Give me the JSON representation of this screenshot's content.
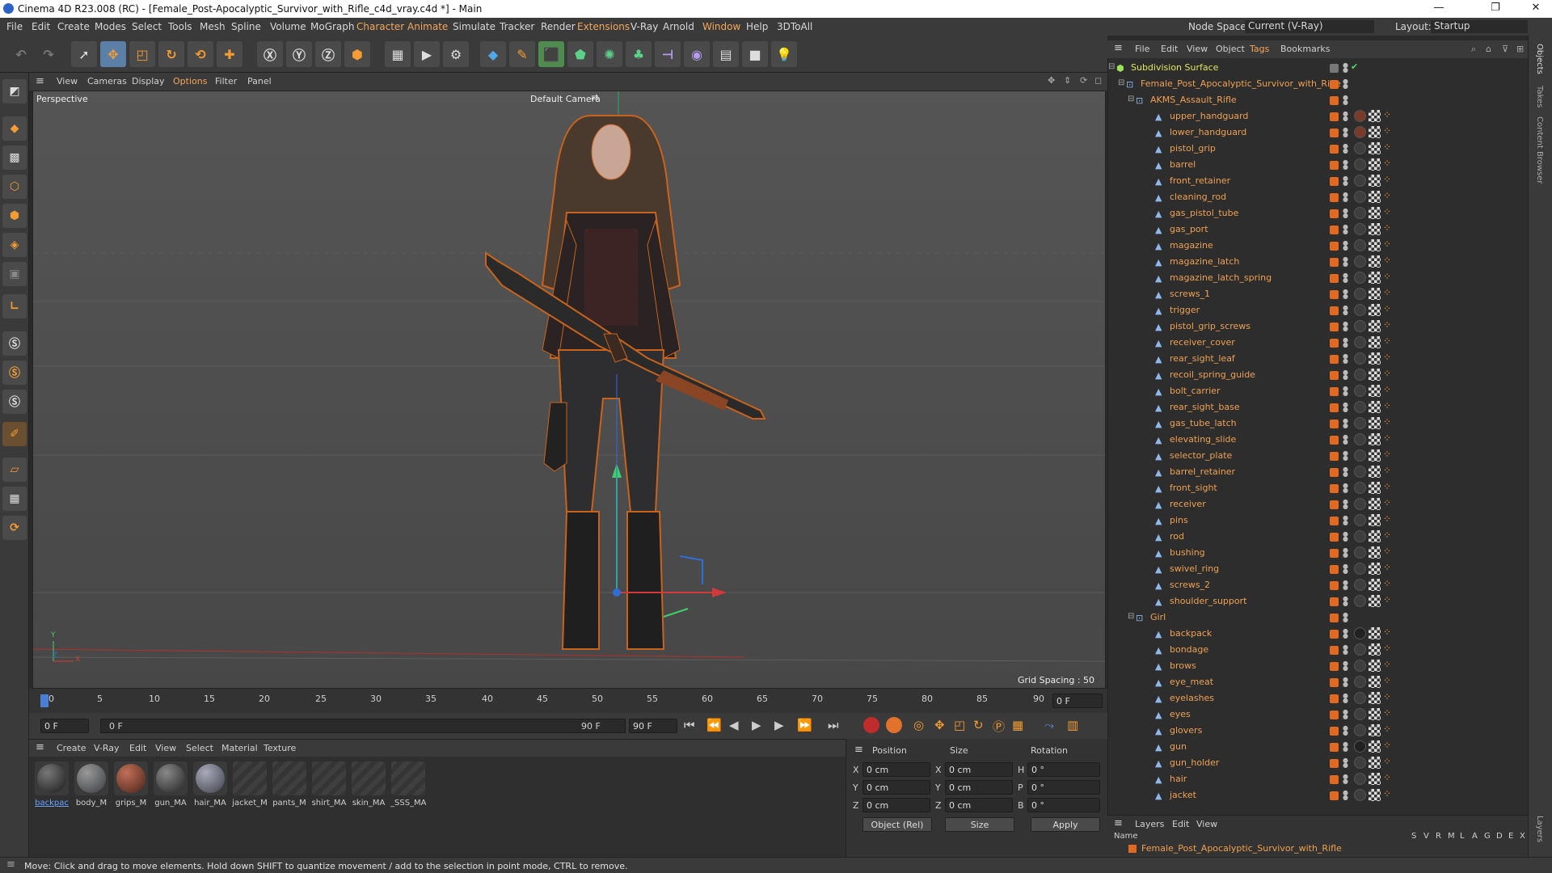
{
  "window": {
    "title": "Cinema 4D R23.008 (RC) - [Female_Post-Apocalyptic_Survivor_with_Rifle_c4d_vray.c4d *] - Main",
    "minimize": "—",
    "maximize": "❐",
    "close": "✕"
  },
  "menubar": {
    "items": [
      "File",
      "Edit",
      "Create",
      "Modes",
      "Select",
      "Tools",
      "Mesh",
      "Spline",
      "Volume",
      "MoGraph",
      "Character",
      "Animate",
      "Simulate",
      "Tracker",
      "Render",
      "Extensions",
      "V-Ray",
      "Arnold",
      "Window",
      "Help",
      "3DToAll"
    ],
    "node_space_label": "Node Space:",
    "node_space_value": "Current (V-Ray)",
    "layout_label": "Layout:",
    "layout_value": "Startup"
  },
  "viewport": {
    "menu": [
      "View",
      "Cameras",
      "Display",
      "Options",
      "Filter",
      "Panel"
    ],
    "name": "Perspective",
    "camera": "Default Camera",
    "grid_spacing": "Grid Spacing : 50 cm",
    "axis_y": "Y",
    "axis_z": "Z",
    "axis_x": "X"
  },
  "timeline": {
    "ticks": [
      "0",
      "5",
      "10",
      "15",
      "20",
      "25",
      "30",
      "35",
      "40",
      "45",
      "50",
      "55",
      "60",
      "65",
      "70",
      "75",
      "80",
      "85",
      "90"
    ],
    "end_field": "0 F",
    "current_start": "0 F",
    "range_start": "0 F",
    "range_end": "90 F",
    "max_field": "90 F"
  },
  "materials": {
    "menu": [
      "Create",
      "V-Ray",
      "Edit",
      "View",
      "Select",
      "Material",
      "Texture"
    ],
    "items": [
      {
        "label": "backpac",
        "color": "#2b2b2b"
      },
      {
        "label": "body_M",
        "color": "#4a4c50"
      },
      {
        "label": "grips_M",
        "color": "#6a3428"
      },
      {
        "label": "gun_MA",
        "color": "#3a3a3a"
      },
      {
        "label": "hair_MA",
        "color": "#5b6068"
      },
      {
        "label": "jacket_M",
        "color": ""
      },
      {
        "label": "pants_M",
        "color": ""
      },
      {
        "label": "shirt_MA",
        "color": ""
      },
      {
        "label": "skin_MA",
        "color": ""
      },
      {
        "label": "_SSS_MA",
        "color": ""
      }
    ]
  },
  "coords": {
    "position": "Position",
    "size": "Size",
    "rotation": "Rotation",
    "x": "X",
    "y": "Y",
    "z": "Z",
    "h": "H",
    "p": "P",
    "b": "B",
    "px": "0 cm",
    "py": "0 cm",
    "pz": "0 cm",
    "sx": "0 cm",
    "sy": "0 cm",
    "sz": "0 cm",
    "rh": "0 °",
    "rp": "0 °",
    "rb": "0 °",
    "mode": "Object (Rel)",
    "size_mode": "Size",
    "apply": "Apply"
  },
  "objects": {
    "menu": [
      "File",
      "Edit",
      "View",
      "Object",
      "Tags",
      "Bookmarks"
    ],
    "root": "Subdivision Surface",
    "group": "Female_Post_Apocalyptic_Survivor_with_Rifle",
    "rifle_group": "AKMS_Assault_Rifle",
    "rifle_parts": [
      "upper_handguard",
      "lower_handguard",
      "pistol_grip",
      "barrel",
      "front_retainer",
      "cleaning_rod",
      "gas_pistol_tube",
      "gas_port",
      "magazine",
      "magazine_latch",
      "magazine_latch_spring",
      "screws_1",
      "trigger",
      "pistol_grip_screws",
      "receiver_cover",
      "rear_sight_leaf",
      "recoil_spring_guide",
      "bolt_carrier",
      "rear_sight_base",
      "gas_tube_latch",
      "elevating_slide",
      "selector_plate",
      "barrel_retainer",
      "front_sight",
      "receiver",
      "pins",
      "rod",
      "bushing",
      "swivel_ring",
      "screws_2",
      "shoulder_support"
    ],
    "girl_group": "Girl",
    "girl_parts": [
      "backpack",
      "bondage",
      "brows",
      "eye_meat",
      "eyelashes",
      "eyes",
      "glovers",
      "gun",
      "gun_holder",
      "hair",
      "jacket"
    ]
  },
  "layers": {
    "menu": [
      "Layers",
      "Edit",
      "View"
    ],
    "name_col": "Name",
    "cols": [
      "S",
      "V",
      "R",
      "M",
      "L",
      "A",
      "G",
      "D",
      "E",
      "X"
    ],
    "row": "Female_Post_Apocalyptic_Survivor_with_Rifle"
  },
  "right_strip": [
    "Objects",
    "Takes",
    "Content Browser",
    "Layers"
  ],
  "status": "Move: Click and drag to move elements. Hold down SHIFT to quantize movement / add to the selection in point mode, CTRL to remove."
}
